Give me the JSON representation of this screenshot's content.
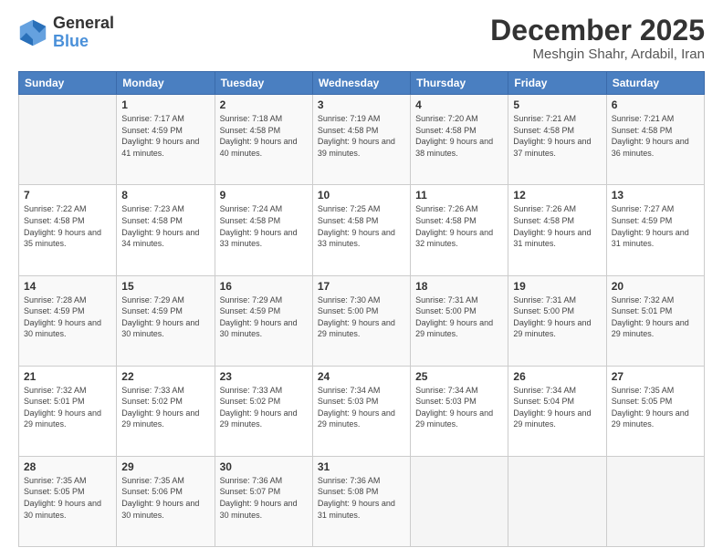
{
  "logo": {
    "line1": "General",
    "line2": "Blue"
  },
  "title": "December 2025",
  "subtitle": "Meshgin Shahr, Ardabil, Iran",
  "header": {
    "days": [
      "Sunday",
      "Monday",
      "Tuesday",
      "Wednesday",
      "Thursday",
      "Friday",
      "Saturday"
    ]
  },
  "weeks": [
    [
      {
        "day": "",
        "sunrise": "",
        "sunset": "",
        "daylight": ""
      },
      {
        "day": "1",
        "sunrise": "Sunrise: 7:17 AM",
        "sunset": "Sunset: 4:59 PM",
        "daylight": "Daylight: 9 hours and 41 minutes."
      },
      {
        "day": "2",
        "sunrise": "Sunrise: 7:18 AM",
        "sunset": "Sunset: 4:58 PM",
        "daylight": "Daylight: 9 hours and 40 minutes."
      },
      {
        "day": "3",
        "sunrise": "Sunrise: 7:19 AM",
        "sunset": "Sunset: 4:58 PM",
        "daylight": "Daylight: 9 hours and 39 minutes."
      },
      {
        "day": "4",
        "sunrise": "Sunrise: 7:20 AM",
        "sunset": "Sunset: 4:58 PM",
        "daylight": "Daylight: 9 hours and 38 minutes."
      },
      {
        "day": "5",
        "sunrise": "Sunrise: 7:21 AM",
        "sunset": "Sunset: 4:58 PM",
        "daylight": "Daylight: 9 hours and 37 minutes."
      },
      {
        "day": "6",
        "sunrise": "Sunrise: 7:21 AM",
        "sunset": "Sunset: 4:58 PM",
        "daylight": "Daylight: 9 hours and 36 minutes."
      }
    ],
    [
      {
        "day": "7",
        "sunrise": "Sunrise: 7:22 AM",
        "sunset": "Sunset: 4:58 PM",
        "daylight": "Daylight: 9 hours and 35 minutes."
      },
      {
        "day": "8",
        "sunrise": "Sunrise: 7:23 AM",
        "sunset": "Sunset: 4:58 PM",
        "daylight": "Daylight: 9 hours and 34 minutes."
      },
      {
        "day": "9",
        "sunrise": "Sunrise: 7:24 AM",
        "sunset": "Sunset: 4:58 PM",
        "daylight": "Daylight: 9 hours and 33 minutes."
      },
      {
        "day": "10",
        "sunrise": "Sunrise: 7:25 AM",
        "sunset": "Sunset: 4:58 PM",
        "daylight": "Daylight: 9 hours and 33 minutes."
      },
      {
        "day": "11",
        "sunrise": "Sunrise: 7:26 AM",
        "sunset": "Sunset: 4:58 PM",
        "daylight": "Daylight: 9 hours and 32 minutes."
      },
      {
        "day": "12",
        "sunrise": "Sunrise: 7:26 AM",
        "sunset": "Sunset: 4:58 PM",
        "daylight": "Daylight: 9 hours and 31 minutes."
      },
      {
        "day": "13",
        "sunrise": "Sunrise: 7:27 AM",
        "sunset": "Sunset: 4:59 PM",
        "daylight": "Daylight: 9 hours and 31 minutes."
      }
    ],
    [
      {
        "day": "14",
        "sunrise": "Sunrise: 7:28 AM",
        "sunset": "Sunset: 4:59 PM",
        "daylight": "Daylight: 9 hours and 30 minutes."
      },
      {
        "day": "15",
        "sunrise": "Sunrise: 7:29 AM",
        "sunset": "Sunset: 4:59 PM",
        "daylight": "Daylight: 9 hours and 30 minutes."
      },
      {
        "day": "16",
        "sunrise": "Sunrise: 7:29 AM",
        "sunset": "Sunset: 4:59 PM",
        "daylight": "Daylight: 9 hours and 30 minutes."
      },
      {
        "day": "17",
        "sunrise": "Sunrise: 7:30 AM",
        "sunset": "Sunset: 5:00 PM",
        "daylight": "Daylight: 9 hours and 29 minutes."
      },
      {
        "day": "18",
        "sunrise": "Sunrise: 7:31 AM",
        "sunset": "Sunset: 5:00 PM",
        "daylight": "Daylight: 9 hours and 29 minutes."
      },
      {
        "day": "19",
        "sunrise": "Sunrise: 7:31 AM",
        "sunset": "Sunset: 5:00 PM",
        "daylight": "Daylight: 9 hours and 29 minutes."
      },
      {
        "day": "20",
        "sunrise": "Sunrise: 7:32 AM",
        "sunset": "Sunset: 5:01 PM",
        "daylight": "Daylight: 9 hours and 29 minutes."
      }
    ],
    [
      {
        "day": "21",
        "sunrise": "Sunrise: 7:32 AM",
        "sunset": "Sunset: 5:01 PM",
        "daylight": "Daylight: 9 hours and 29 minutes."
      },
      {
        "day": "22",
        "sunrise": "Sunrise: 7:33 AM",
        "sunset": "Sunset: 5:02 PM",
        "daylight": "Daylight: 9 hours and 29 minutes."
      },
      {
        "day": "23",
        "sunrise": "Sunrise: 7:33 AM",
        "sunset": "Sunset: 5:02 PM",
        "daylight": "Daylight: 9 hours and 29 minutes."
      },
      {
        "day": "24",
        "sunrise": "Sunrise: 7:34 AM",
        "sunset": "Sunset: 5:03 PM",
        "daylight": "Daylight: 9 hours and 29 minutes."
      },
      {
        "day": "25",
        "sunrise": "Sunrise: 7:34 AM",
        "sunset": "Sunset: 5:03 PM",
        "daylight": "Daylight: 9 hours and 29 minutes."
      },
      {
        "day": "26",
        "sunrise": "Sunrise: 7:34 AM",
        "sunset": "Sunset: 5:04 PM",
        "daylight": "Daylight: 9 hours and 29 minutes."
      },
      {
        "day": "27",
        "sunrise": "Sunrise: 7:35 AM",
        "sunset": "Sunset: 5:05 PM",
        "daylight": "Daylight: 9 hours and 29 minutes."
      }
    ],
    [
      {
        "day": "28",
        "sunrise": "Sunrise: 7:35 AM",
        "sunset": "Sunset: 5:05 PM",
        "daylight": "Daylight: 9 hours and 30 minutes."
      },
      {
        "day": "29",
        "sunrise": "Sunrise: 7:35 AM",
        "sunset": "Sunset: 5:06 PM",
        "daylight": "Daylight: 9 hours and 30 minutes."
      },
      {
        "day": "30",
        "sunrise": "Sunrise: 7:36 AM",
        "sunset": "Sunset: 5:07 PM",
        "daylight": "Daylight: 9 hours and 30 minutes."
      },
      {
        "day": "31",
        "sunrise": "Sunrise: 7:36 AM",
        "sunset": "Sunset: 5:08 PM",
        "daylight": "Daylight: 9 hours and 31 minutes."
      },
      {
        "day": "",
        "sunrise": "",
        "sunset": "",
        "daylight": ""
      },
      {
        "day": "",
        "sunrise": "",
        "sunset": "",
        "daylight": ""
      },
      {
        "day": "",
        "sunrise": "",
        "sunset": "",
        "daylight": ""
      }
    ]
  ]
}
